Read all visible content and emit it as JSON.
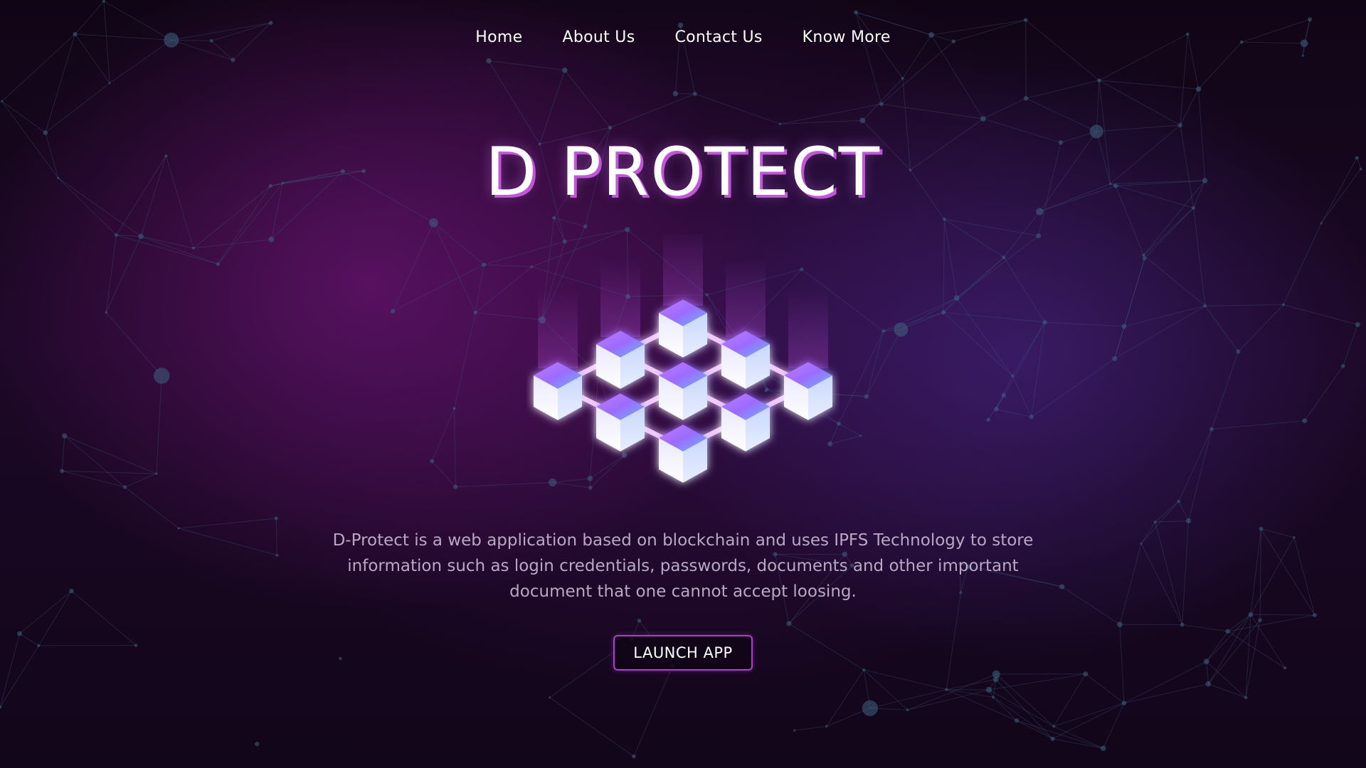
{
  "nav": {
    "items": [
      {
        "label": "Home"
      },
      {
        "label": "About Us"
      },
      {
        "label": "Contact Us"
      },
      {
        "label": "Know More"
      }
    ]
  },
  "hero": {
    "title": "D PROTECT",
    "graphic_icon": "blockchain-cubes-icon",
    "description": "D-Protect is a web application based on blockchain and uses IPFS Technology to store information such as login credentials, passwords, documents and other important document that one cannot accept loosing.",
    "cta_label": "LAUNCH APP"
  },
  "theme": {
    "background": "#14061c",
    "accent": "#b33ad6",
    "title_shadow": "#c156d8",
    "description_color": "#b9a8c4"
  }
}
